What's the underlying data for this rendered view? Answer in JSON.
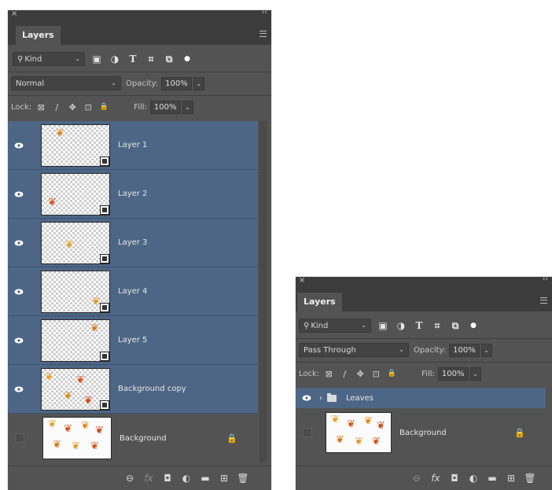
{
  "left_panel": {
    "close_glyph": "×",
    "collapse_glyph": "‹‹",
    "tab_label": "Layers",
    "filter": {
      "value": "Kind",
      "icons": [
        "image-icon",
        "adjustment-icon",
        "type-icon",
        "shape-icon",
        "smart-object-icon",
        "filter-toggle-icon"
      ],
      "icon_glyphs": [
        "▣",
        "◑",
        "T",
        "⌗",
        "⧉",
        "●"
      ]
    },
    "blend_mode": "Normal",
    "opacity_label": "Opacity:",
    "opacity_value": "100%",
    "lock_label": "Lock:",
    "fill_label": "Fill:",
    "fill_value": "100%",
    "layers": [
      {
        "name": "Layer 1",
        "selected": true,
        "visible": true,
        "smart_object": true
      },
      {
        "name": "Layer 2",
        "selected": true,
        "visible": true,
        "smart_object": true
      },
      {
        "name": "Layer 3",
        "selected": true,
        "visible": true,
        "smart_object": true
      },
      {
        "name": "Layer 4",
        "selected": true,
        "visible": true,
        "smart_object": true
      },
      {
        "name": "Layer 5",
        "selected": true,
        "visible": true,
        "smart_object": true
      },
      {
        "name": "Background copy",
        "selected": true,
        "visible": true,
        "smart_object": true
      },
      {
        "name": "Background",
        "selected": false,
        "visible": false,
        "locked": true
      }
    ],
    "footer_icons": [
      "link-icon",
      "fx-icon",
      "mask-icon",
      "adjustment-layer-icon",
      "group-icon",
      "new-layer-icon",
      "trash-icon"
    ],
    "footer_glyphs": [
      "⊖",
      "fx",
      "◘",
      "◐",
      "▬",
      "⊞",
      "🗑"
    ]
  },
  "right_panel": {
    "close_glyph": "×",
    "collapse_glyph": "‹‹",
    "tab_label": "Layers",
    "filter": {
      "value": "Kind",
      "icon_glyphs": [
        "▣",
        "◑",
        "T",
        "⌗",
        "⧉",
        "●"
      ]
    },
    "blend_mode": "Pass Through",
    "opacity_label": "Opacity:",
    "opacity_value": "100%",
    "lock_label": "Lock:",
    "fill_label": "Fill:",
    "fill_value": "100%",
    "group": {
      "name": "Leaves",
      "selected": true,
      "visible": true,
      "chevron": "›"
    },
    "background": {
      "name": "Background",
      "locked": true
    },
    "footer_glyphs": [
      "⊖",
      "fx",
      "◘",
      "◐",
      "▬",
      "⊞",
      "🗑"
    ]
  },
  "lock_glyphs": [
    "⊠",
    "∕",
    "✥",
    "⊡",
    "🔒"
  ],
  "colors": {
    "panel": "#535353",
    "header": "#3c3c3c",
    "selected": "#4d6685"
  }
}
